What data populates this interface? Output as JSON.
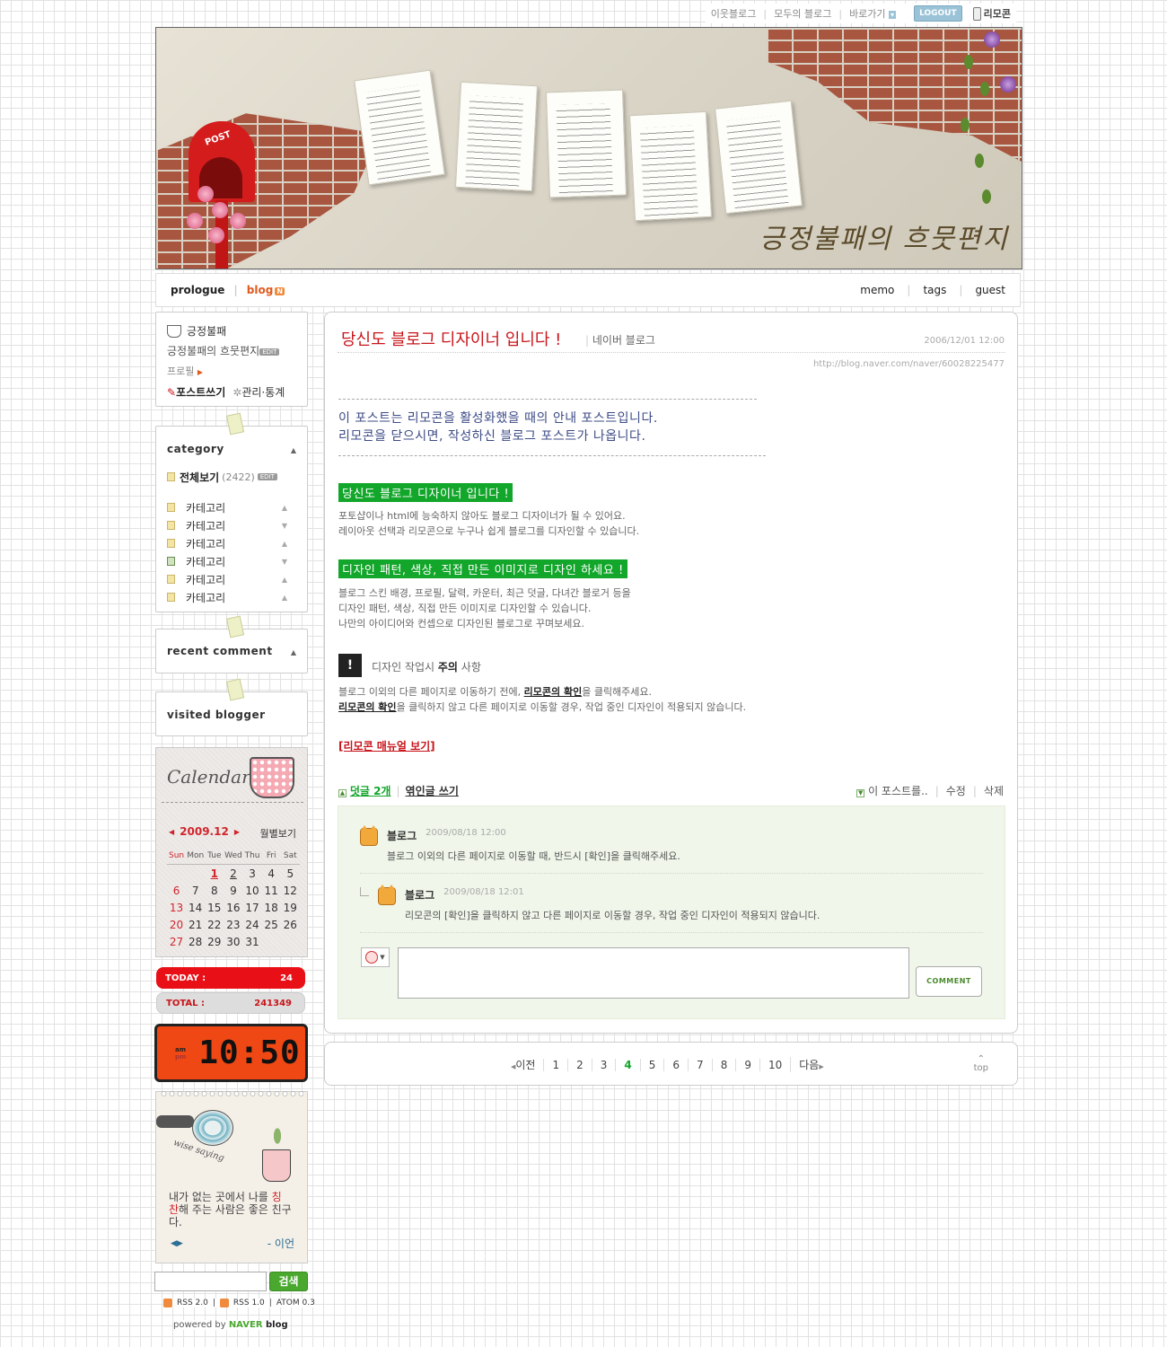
{
  "topbar": {
    "neighbor": "이웃블로그",
    "everyone": "모두의 블로그",
    "goto": "바로가기",
    "logout": "LOGOUT",
    "remote": "리모콘"
  },
  "banner": {
    "title": "긍정불패의 흐뭇편지",
    "mailbox_label": "POST"
  },
  "nav": {
    "prologue": "prologue",
    "blog": "blog",
    "new_badge": "N",
    "memo": "memo",
    "tags": "tags",
    "guest": "guest"
  },
  "profile": {
    "nickname": "긍정불패",
    "blog_name": "긍정불패의 흐뭇편지",
    "edit": "EDIT",
    "profile_link": "프로필",
    "write": "포스트쓰기",
    "manage": "관리·통계"
  },
  "category": {
    "header": "category",
    "all_label": "전체보기",
    "all_count": "(2422)",
    "edit": "EDIT",
    "items": [
      {
        "label": "카테고리",
        "icon": "folder-icon"
      },
      {
        "label": "카테고리",
        "icon": "folder-icon"
      },
      {
        "label": "카테고리",
        "icon": "folder-icon"
      },
      {
        "label": "카테고리",
        "icon": "image-folder-icon"
      },
      {
        "label": "카테고리",
        "icon": "folder-icon"
      },
      {
        "label": "카테고리",
        "icon": "folder-icon"
      }
    ]
  },
  "recent_comment": {
    "header": "recent comment"
  },
  "visited_blogger": {
    "header": "visited blogger"
  },
  "calendar": {
    "title": "Calendar",
    "month": "2009.12",
    "monthly": "월별보기",
    "weekdays": [
      "Sun",
      "Mon",
      "Tue",
      "Wed",
      "Thu",
      "Fri",
      "Sat"
    ],
    "weeks": [
      [
        "",
        "",
        "1",
        "2",
        "3",
        "4",
        "5"
      ],
      [
        "6",
        "7",
        "8",
        "9",
        "10",
        "11",
        "12"
      ],
      [
        "13",
        "14",
        "15",
        "16",
        "17",
        "18",
        "19"
      ],
      [
        "20",
        "21",
        "22",
        "23",
        "24",
        "25",
        "26"
      ],
      [
        "27",
        "28",
        "29",
        "30",
        "31",
        "",
        ""
      ]
    ],
    "today": "1"
  },
  "counter": {
    "today_label": "TODAY :",
    "today_value": "24",
    "total_label": "TOTAL :",
    "total_value": "241349"
  },
  "clock": {
    "am": "am",
    "pm": "pm",
    "time": "10:50"
  },
  "wise": {
    "word": "wise saying",
    "text_before": "내가 없는 곳에서 나를 ",
    "text_highlight_a": "칭",
    "text_highlight_b": "찬",
    "text_after": "해 주는 사람은 좋은 친구다.",
    "author": "- 이언"
  },
  "search": {
    "button": "검색",
    "value": ""
  },
  "feeds": {
    "rss20": "RSS 2.0",
    "rss10": "RSS 1.0",
    "atom": "ATOM 0.3"
  },
  "powered": {
    "prefix": "powered by ",
    "naver": "NAVER",
    "blog": " blog"
  },
  "post": {
    "title": "당신도 블로그 디자이너 입니다 !",
    "category": "네이버 블로그",
    "date": "2006/12/01 12:00",
    "url": "http://blog.naver.com/naver/60028225477",
    "intro1": "이 포스트는 리모콘을 활성화했을 때의 안내 포스트입니다.",
    "intro2": "리모콘을 닫으시면, 작성하신 블로그 포스트가 나옵니다.",
    "h1": "당신도 블로그 디자이너 입니다 !",
    "p1a": "포토샵이나 html에 능숙하지 않아도 블로그 디자이너가 될 수 있어요.",
    "p1b": "레이아웃 선택과 리모콘으로 누구나 쉽게 블로그를 디자인할 수 있습니다.",
    "h2": "디자인 패턴, 색상, 직접 만든 이미지로 디자인 하세요 !",
    "p2a": "블로그 스킨 배경, 프로필, 달력, 카운터, 최근 덧글, 다녀간 블로거 등을",
    "p2b": "디자인 패턴, 색상, 직접 만든 이미지로 디자인할 수 있습니다.",
    "p2c": "나만의 아이디어와 컨셉으로 디자인된 블로그로 꾸며보세요.",
    "notice_pre": "디자인 작업시 ",
    "notice_bold": "주의",
    "notice_post": " 사항",
    "n1a": "블로그 이외의 다른 페이지로 이동하기 전에, ",
    "n1b": "리모콘의 확인",
    "n1c": "을 클릭해주세요.",
    "n2a": "리모콘의 확인",
    "n2b": "을 클릭하지 않고 다른 페이지로 이동할 경우, 작업 중인 디자인이 적용되지 않습니다.",
    "manual": "[리모콘 매뉴얼 보기]",
    "comments_link": "덧글 2개",
    "trackback": "엮인글 쓰기",
    "this_post": "이 포스트를..",
    "modify": "수정",
    "delete": "삭제"
  },
  "comments": [
    {
      "author": "블로그",
      "date": "2009/08/18 12:00",
      "text": "블로그 이외의 다른 페이지로 이동할 때, 반드시 [확인]을 클릭해주세요."
    },
    {
      "author": "블로그",
      "date": "2009/08/18 12:01",
      "text": "리모콘의 [확인]을 클릭하지 않고 다른 페이지로 이동할 경우, 작업 중인 디자인이 적용되지 않습니다."
    }
  ],
  "comment_form": {
    "button": "COMMENT",
    "value": ""
  },
  "pager": {
    "prev": "이전",
    "pages": [
      "1",
      "2",
      "3",
      "4",
      "5",
      "6",
      "7",
      "8",
      "9",
      "10"
    ],
    "current": "4",
    "next": "다음",
    "top": "top"
  }
}
